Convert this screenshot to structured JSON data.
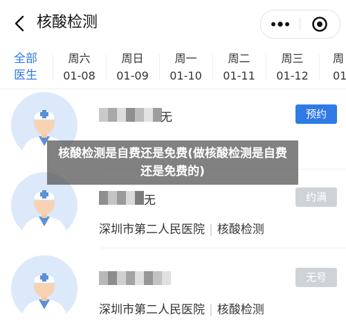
{
  "header": {
    "title": "核酸检测",
    "back_icon": "chevron-left-icon",
    "more_icon": "more-dots-icon",
    "close_icon": "target-close-icon"
  },
  "dates": {
    "all_label_line1": "全部",
    "all_label_line2": "医生",
    "items": [
      {
        "weekday": "周六",
        "date": "01-08"
      },
      {
        "weekday": "周日",
        "date": "01-09"
      },
      {
        "weekday": "周一",
        "date": "01-10"
      },
      {
        "weekday": "周二",
        "date": "01-11"
      },
      {
        "weekday": "周三",
        "date": "01-12"
      },
      {
        "weekday": "周",
        "date": "01-"
      }
    ]
  },
  "doctors": [
    {
      "title_suffix": "无",
      "hospital": "",
      "department": "",
      "button": "预约",
      "button_color": "#2f7ae5"
    },
    {
      "title_suffix": "无",
      "hospital": "深圳市第二人民医院",
      "department": "核酸检测",
      "button": "约满",
      "button_color": "#cfd3d8"
    },
    {
      "title_suffix": "",
      "hospital": "深圳市第二人民医院",
      "department": "核酸检测",
      "button": "无号",
      "button_color": "#cfd3d8"
    }
  ],
  "overlay": {
    "caption": "核酸检测是自费还是免费(做核酸检测是自费还是免费的)"
  },
  "colors": {
    "accent": "#2f7ae5",
    "disabled": "#cfd3d8",
    "avatar_bg": "#dbe9fa"
  }
}
